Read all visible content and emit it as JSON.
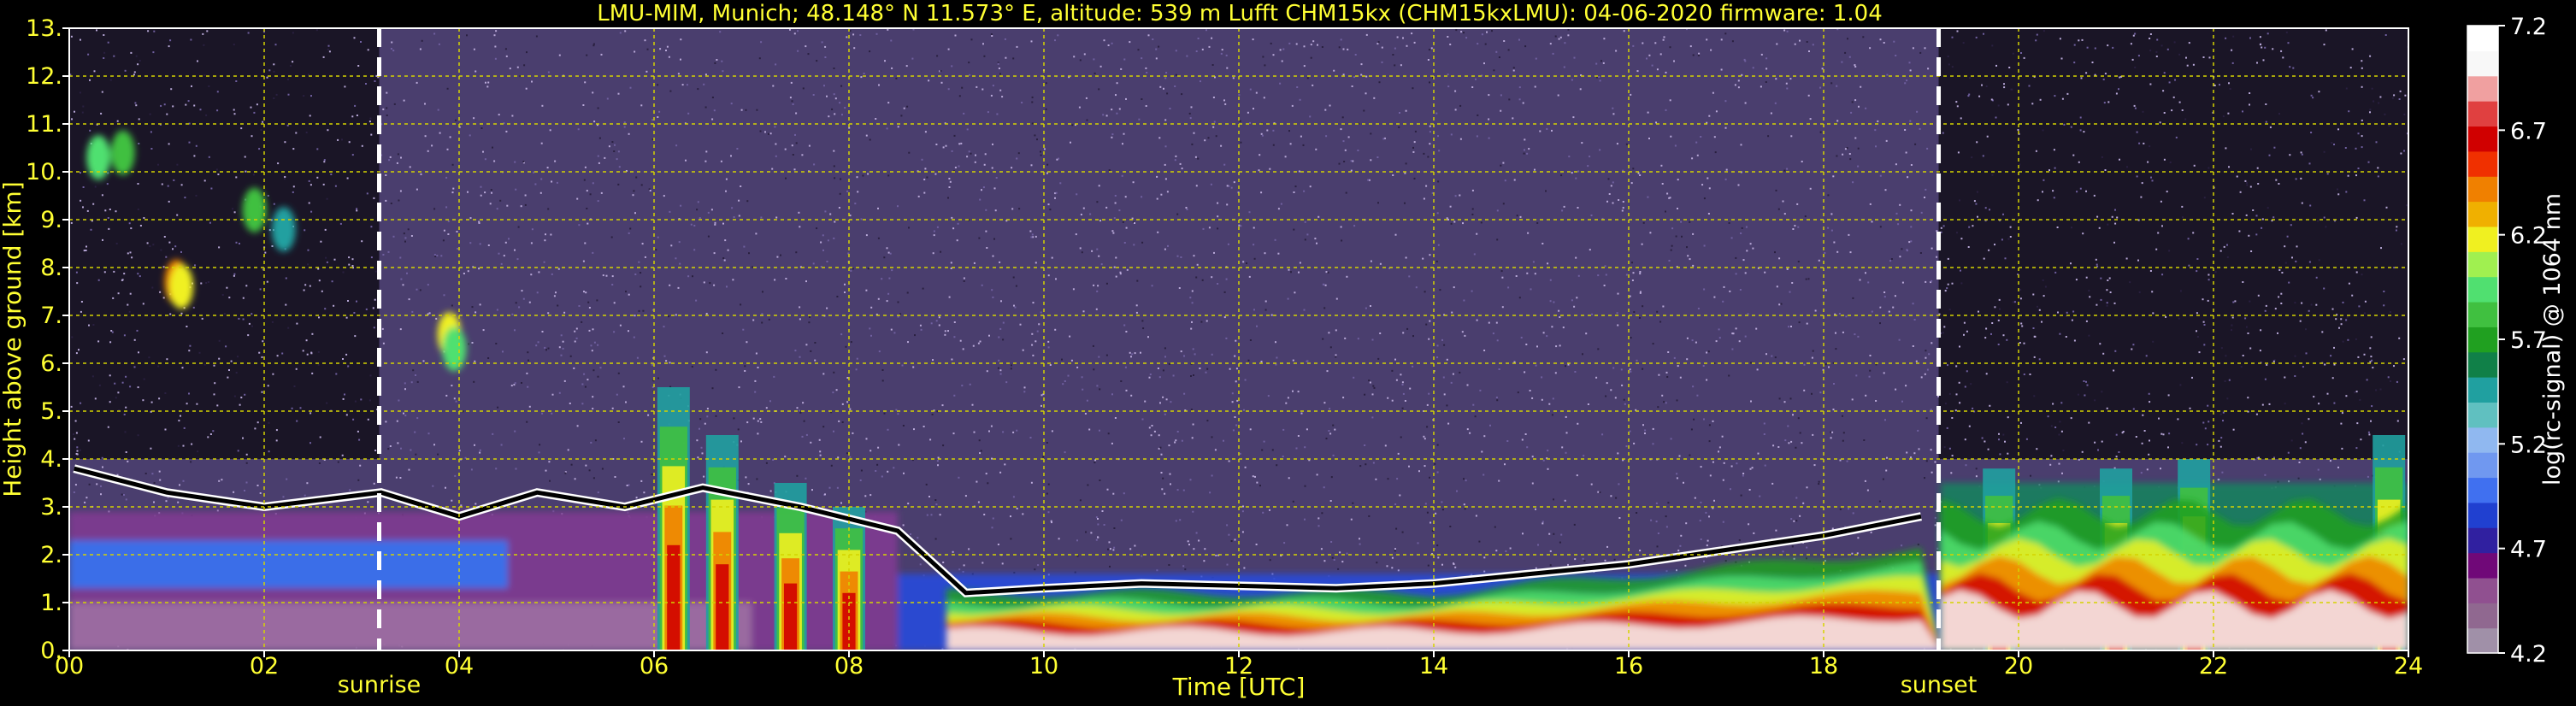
{
  "chart_data": {
    "type": "heatmap",
    "title": "LMU-MIM, Munich; 48.148° N 11.573° E, altitude: 539 m    Lufft CHM15kx (CHM15kxLMU): 04-06-2020    firmware: 1.04",
    "xlabel": "Time [UTC]",
    "ylabel": "Height above ground [km]",
    "xlim": [
      0,
      24
    ],
    "ylim": [
      0,
      13
    ],
    "x_ticks": [
      {
        "value": 0,
        "label": "00"
      },
      {
        "value": 2,
        "label": "02"
      },
      {
        "value": 4,
        "label": "04"
      },
      {
        "value": 6,
        "label": "06"
      },
      {
        "value": 8,
        "label": "08"
      },
      {
        "value": 10,
        "label": "10"
      },
      {
        "value": 12,
        "label": "12"
      },
      {
        "value": 14,
        "label": "14"
      },
      {
        "value": 16,
        "label": "16"
      },
      {
        "value": 18,
        "label": "18"
      },
      {
        "value": 20,
        "label": "20"
      },
      {
        "value": 22,
        "label": "22"
      },
      {
        "value": 24,
        "label": "24"
      }
    ],
    "y_ticks": [
      {
        "value": 0,
        "label": "0."
      },
      {
        "value": 1,
        "label": "1."
      },
      {
        "value": 2,
        "label": "2."
      },
      {
        "value": 3,
        "label": "3."
      },
      {
        "value": 4,
        "label": "4."
      },
      {
        "value": 5,
        "label": "5."
      },
      {
        "value": 6,
        "label": "6."
      },
      {
        "value": 7,
        "label": "7."
      },
      {
        "value": 8,
        "label": "8."
      },
      {
        "value": 9,
        "label": "9."
      },
      {
        "value": 10,
        "label": "10."
      },
      {
        "value": 11,
        "label": "11."
      },
      {
        "value": 12,
        "label": "12."
      },
      {
        "value": 13,
        "label": "13."
      }
    ],
    "grid": true,
    "grid_color": "#d4d400",
    "events": [
      {
        "name": "sunrise",
        "x": 3.18
      },
      {
        "name": "sunset",
        "x": 19.18
      }
    ],
    "colorbar": {
      "label": "log(rc-signal) @ 1064 nm",
      "range": [
        4.2,
        7.2
      ],
      "ticks": [
        "4.2",
        "4.7",
        "5.2",
        "5.7",
        "6.2",
        "6.7",
        "7.2"
      ],
      "colors": [
        "#a090a8",
        "#906890",
        "#905090",
        "#700878",
        "#3020a0",
        "#2040d0",
        "#4070f0",
        "#7098f0",
        "#90b8f0",
        "#60c0c0",
        "#20a0a0",
        "#108048",
        "#20a020",
        "#40c040",
        "#50e070",
        "#a0f050",
        "#f0f020",
        "#f0b000",
        "#f08000",
        "#f03000",
        "#d00000",
        "#e04040",
        "#f0a0a0",
        "#f8f8f8",
        "#ffffff"
      ]
    },
    "noise_color": "#4a3e6e",
    "noise_speckle_color": "#b8a8d8",
    "cloud_base_layer": [
      {
        "x": 0.05,
        "y": 3.8
      },
      {
        "x": 1.0,
        "y": 3.3
      },
      {
        "x": 2.0,
        "y": 3.0
      },
      {
        "x": 3.2,
        "y": 3.3
      },
      {
        "x": 4.0,
        "y": 2.8
      },
      {
        "x": 4.8,
        "y": 3.3
      },
      {
        "x": 5.7,
        "y": 3.0
      },
      {
        "x": 6.5,
        "y": 3.4
      },
      {
        "x": 7.5,
        "y": 3.0
      },
      {
        "x": 8.5,
        "y": 2.5
      },
      {
        "x": 9.2,
        "y": 1.2
      },
      {
        "x": 10.0,
        "y": 1.3
      },
      {
        "x": 11.0,
        "y": 1.4
      },
      {
        "x": 12.0,
        "y": 1.35
      },
      {
        "x": 13.0,
        "y": 1.3
      },
      {
        "x": 14.0,
        "y": 1.4
      },
      {
        "x": 15.0,
        "y": 1.6
      },
      {
        "x": 16.0,
        "y": 1.8
      },
      {
        "x": 17.0,
        "y": 2.1
      },
      {
        "x": 18.0,
        "y": 2.4
      },
      {
        "x": 19.0,
        "y": 2.8
      }
    ],
    "convective_plumes": [
      {
        "x": 6.2,
        "top": 5.5
      },
      {
        "x": 6.7,
        "top": 4.5
      },
      {
        "x": 7.4,
        "top": 3.5
      },
      {
        "x": 8.0,
        "top": 3.0
      },
      {
        "x": 19.8,
        "top": 3.8
      },
      {
        "x": 21.0,
        "top": 3.8
      },
      {
        "x": 21.8,
        "top": 4.0
      },
      {
        "x": 23.8,
        "top": 4.5
      }
    ]
  }
}
